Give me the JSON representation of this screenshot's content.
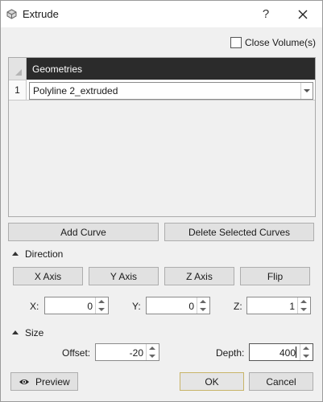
{
  "window": {
    "title": "Extrude",
    "help_label": "?"
  },
  "options": {
    "close_volume_label": "Close Volume(s)",
    "close_volume_checked": false
  },
  "geometries": {
    "column_header": "Geometries",
    "rows": [
      {
        "number": "1",
        "value": "Polyline 2_extruded"
      }
    ]
  },
  "curve_buttons": {
    "add": "Add Curve",
    "delete": "Delete Selected Curves"
  },
  "direction": {
    "label": "Direction",
    "x_axis": "X Axis",
    "y_axis": "Y Axis",
    "z_axis": "Z Axis",
    "flip": "Flip",
    "x_label": "X:",
    "x_value": "0",
    "y_label": "Y:",
    "y_value": "0",
    "z_label": "Z:",
    "z_value": "1"
  },
  "size": {
    "label": "Size",
    "offset_label": "Offset:",
    "offset_value": "-20",
    "depth_label": "Depth:",
    "depth_value": "400"
  },
  "footer": {
    "preview": "Preview",
    "ok": "OK",
    "cancel": "Cancel"
  },
  "icons": [
    "app-icon",
    "help-icon",
    "close-icon",
    "checkbox-icon",
    "dropdown-arrow-icon",
    "collapse-arrow-icon",
    "spinner-up-icon",
    "spinner-down-icon",
    "eye-icon"
  ]
}
